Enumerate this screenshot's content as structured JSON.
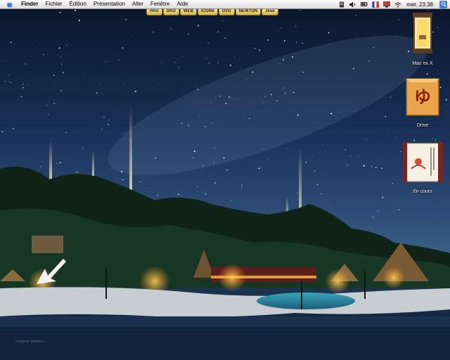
{
  "menubar": {
    "items": [
      "Finder",
      "Fichier",
      "Édition",
      "Présentation",
      "Aller",
      "Fenêtre",
      "Aide"
    ],
    "clock": "mer. 23:38",
    "extras": [
      "script-icon",
      "volume-icon",
      "battery-icon",
      "flag-icon",
      "display-icon",
      "wifi-icon",
      "spotlight-icon"
    ]
  },
  "tabs": [
    "PAO",
    "DAO",
    "WEB",
    "ICONS",
    "DVD",
    "NEWTON",
    "Jeux"
  ],
  "desktop_icons": [
    {
      "label": "Mac os X",
      "icon": "lantern-icon"
    },
    {
      "label": "Drive",
      "icon": "drive-box-icon"
    },
    {
      "label": "En cours",
      "icon": "scroll-icon"
    }
  ],
  "wallpaper": {
    "credit": "HYBRID WORKS"
  },
  "colors": {
    "sky_top": "#0c1a33",
    "sky_mid": "#1f3c66",
    "beach": "#c9cfd2",
    "tab_gold": "#e6c955"
  }
}
